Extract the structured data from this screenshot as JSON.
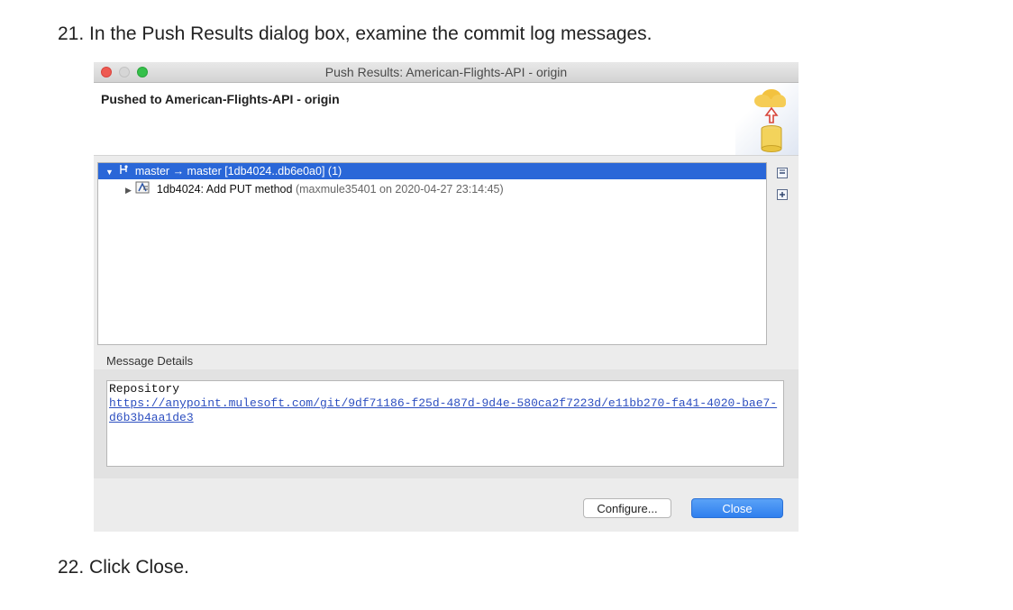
{
  "doc": {
    "step21": "21. In the Push Results dialog box, examine the commit log messages.",
    "step22": "22. Click Close."
  },
  "dialog": {
    "window_title": "Push Results: American-Flights-API - origin",
    "header": "Pushed to American-Flights-API - origin",
    "tree": {
      "branch_row": "master → master [1db4024..db6e0a0] (1)",
      "commit_row_main": "1db4024: Add PUT method ",
      "commit_row_meta": "(maxmule35401 on 2020-04-27 23:14:45)"
    },
    "message_details_label": "Message Details",
    "repository_label": "Repository",
    "repository_url": "https://anypoint.mulesoft.com/git/9df71186-f25d-487d-9d4e-580ca2f7223d/e11bb270-fa41-4020-bae7-d6b3b4aa1de3",
    "buttons": {
      "configure": "Configure...",
      "close": "Close"
    },
    "icons": [
      "cloud-upload-icon",
      "branch-icon",
      "commit-icon",
      "collapse-all-icon",
      "expand-all-icon"
    ]
  }
}
